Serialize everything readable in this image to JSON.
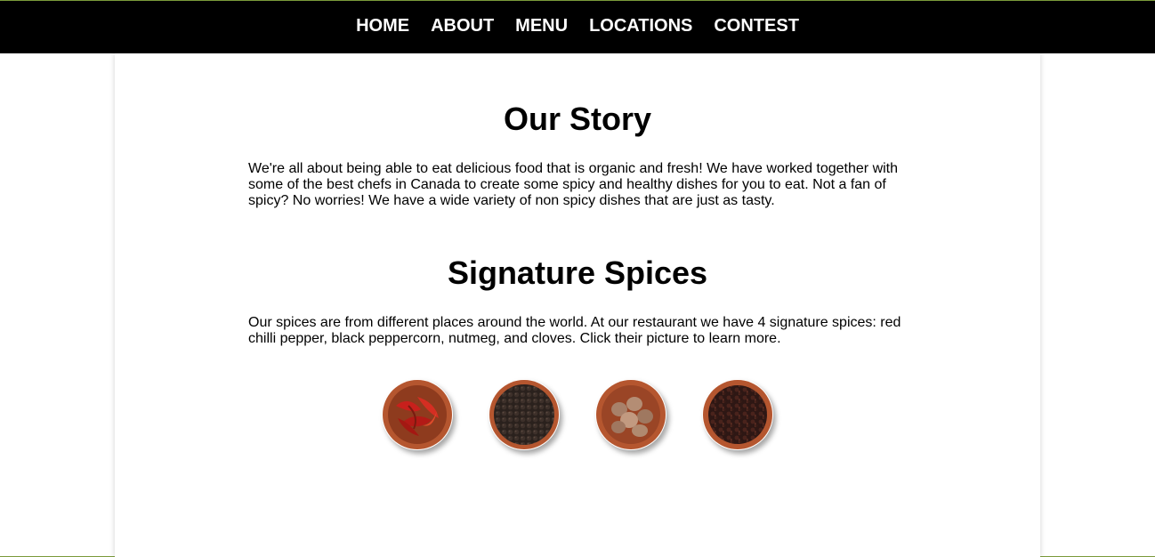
{
  "nav": {
    "items": [
      {
        "label": "HOME"
      },
      {
        "label": "ABOUT"
      },
      {
        "label": "MENU"
      },
      {
        "label": "LOCATIONS"
      },
      {
        "label": "CONTEST"
      }
    ]
  },
  "story": {
    "title": "Our Story",
    "text": "We're all about being able to eat delicious food that is organic and fresh! We have worked together with some of the best chefs in Canada to create some spicy and healthy dishes for you to eat. Not a fan of spicy? No worries! We have a wide variety of non spicy dishes that are just as tasty."
  },
  "spices": {
    "title": "Signature Spices",
    "text": "Our spices are from different places around the world. At our restaurant we have 4 signature spices: red chilli pepper, black peppercorn, nutmeg, and cloves. Click their picture to learn more.",
    "images": [
      {
        "icon": "red-chilli-pepper-bowl-icon"
      },
      {
        "icon": "black-peppercorn-bowl-icon"
      },
      {
        "icon": "nutmeg-bowl-icon"
      },
      {
        "icon": "cloves-bowl-icon"
      }
    ]
  },
  "colors": {
    "navbar_bg": "#000000",
    "nav_text": "#ffffff",
    "bowl": "#b5562f",
    "accent_line": "#7a9a3a"
  }
}
